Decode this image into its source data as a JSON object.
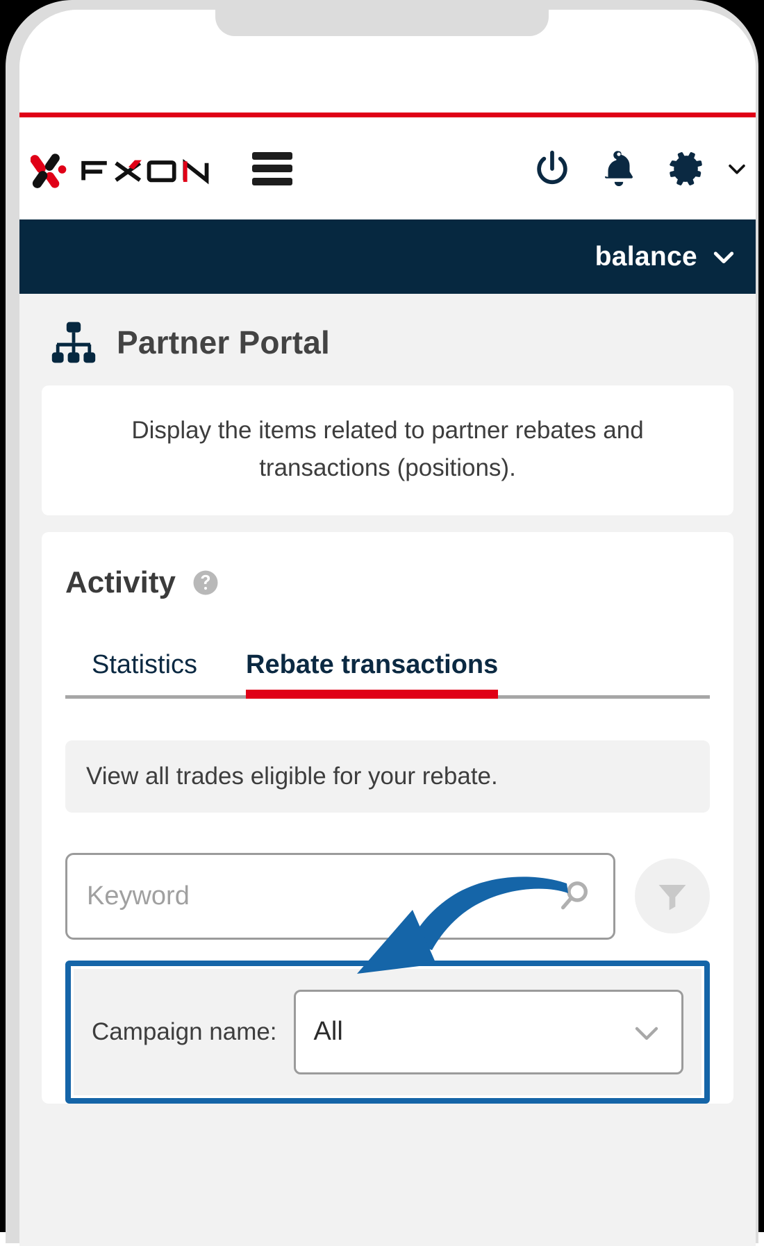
{
  "app": {
    "brand_name": "FXON",
    "accent_red": "#e00017",
    "navy": "#062840",
    "annotation_blue": "#1565a8"
  },
  "header": {
    "logo_label": "FXON",
    "menu_label": "menu",
    "icons": [
      {
        "name": "power-icon",
        "label": "power"
      },
      {
        "name": "bell-icon",
        "label": "notifications"
      },
      {
        "name": "gear-icon",
        "label": "settings"
      },
      {
        "name": "chevron-down-icon",
        "label": "expand"
      }
    ]
  },
  "balance_bar": {
    "label": "balance",
    "chevron": "chevron-down-icon"
  },
  "page": {
    "title": "Partner Portal",
    "title_icon": "sitemap-icon",
    "description": "Display the items related to partner rebates and transactions (positions)."
  },
  "activity": {
    "title": "Activity",
    "help_icon": "help-circle-icon",
    "tabs": [
      {
        "label": "Statistics",
        "active": false
      },
      {
        "label": "Rebate transactions",
        "active": true
      }
    ],
    "note": "View all trades eligible for your rebate.",
    "search": {
      "placeholder": "Keyword",
      "value": "",
      "icon": "search-icon"
    },
    "filter_button": {
      "icon": "filter-icon",
      "label": "Filter"
    },
    "campaign_filter": {
      "label": "Campaign name:",
      "selected": "All",
      "chevron": "chevron-down-icon",
      "highlighted": true
    }
  },
  "annotation": {
    "arrow_color": "#1565a8",
    "points_to": "campaign-name-filter"
  }
}
